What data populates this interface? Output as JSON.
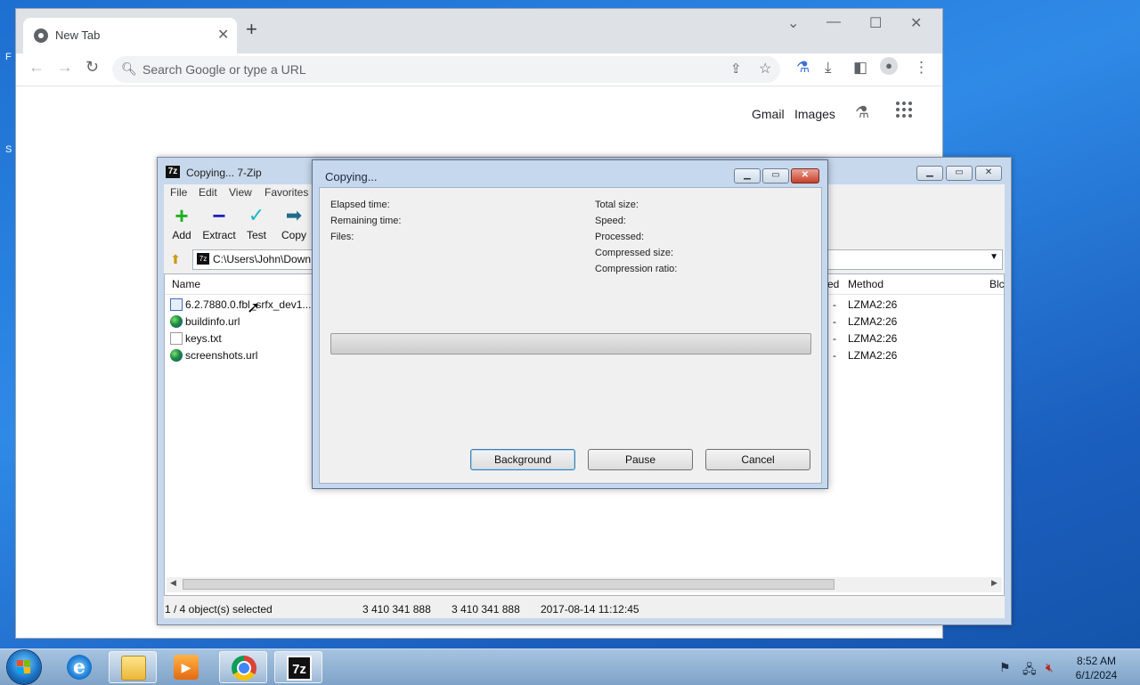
{
  "chrome": {
    "tab_title": "New Tab",
    "tab_close": "✕",
    "new_tab": "+",
    "window_controls": {
      "search_tabs": "⌄",
      "minimize": "—",
      "maximize": "☐",
      "close": "✕"
    },
    "omnibox_placeholder": "Search Google or type a URL",
    "links": {
      "gmail": "Gmail",
      "images": "Images"
    }
  },
  "sevenzip": {
    "title": "Copying... 7-Zip",
    "title_icon": "7z",
    "menu": [
      "File",
      "Edit",
      "View",
      "Favorites"
    ],
    "toolbar": [
      {
        "label": "Add",
        "icon": "add-icon",
        "color": "#1fb11f"
      },
      {
        "label": "Extract",
        "icon": "extract-icon",
        "color": "#1c25b8"
      },
      {
        "label": "Test",
        "icon": "test-icon",
        "color": "#19b7c9"
      },
      {
        "label": "Copy",
        "icon": "copy-icon",
        "color": "#1f6b8a"
      }
    ],
    "path": "C:\\Users\\John\\Down",
    "columns": {
      "name": "Name",
      "ed": "ed",
      "method": "Method",
      "block": "Blc"
    },
    "files": [
      {
        "name": "6.2.7880.0.fbl_srfx_dev1....",
        "icon": "binary-file-icon",
        "dash": "-",
        "method": "LZMA2:26"
      },
      {
        "name": "buildinfo.url",
        "icon": "url-globe-icon",
        "dash": "-",
        "method": "LZMA2:26"
      },
      {
        "name": "keys.txt",
        "icon": "text-file-icon",
        "dash": "-",
        "method": "LZMA2:26"
      },
      {
        "name": "screenshots.url",
        "icon": "url-globe-icon",
        "dash": "-",
        "method": "LZMA2:26"
      }
    ],
    "status": {
      "selected": "1 / 4 object(s) selected",
      "size": "3 410 341 888",
      "packed": "3 410 341 888",
      "modified": "2017-08-14 11:12:45"
    }
  },
  "dialog": {
    "title": "Copying...",
    "left_labels": [
      "Elapsed time:",
      "Remaining time:",
      "Files:"
    ],
    "right_labels": [
      "Total size:",
      "Speed:",
      "Processed:",
      "Compressed size:",
      "Compression ratio:"
    ],
    "progress": 0,
    "buttons": {
      "background": "Background",
      "pause": "Pause",
      "cancel": "Cancel"
    }
  },
  "taskbar": {
    "time": "8:52 AM",
    "date": "6/1/2024",
    "apps": [
      "internet-explorer-icon",
      "file-explorer-icon",
      "media-player-icon",
      "chrome-icon",
      "7zip-icon"
    ]
  }
}
